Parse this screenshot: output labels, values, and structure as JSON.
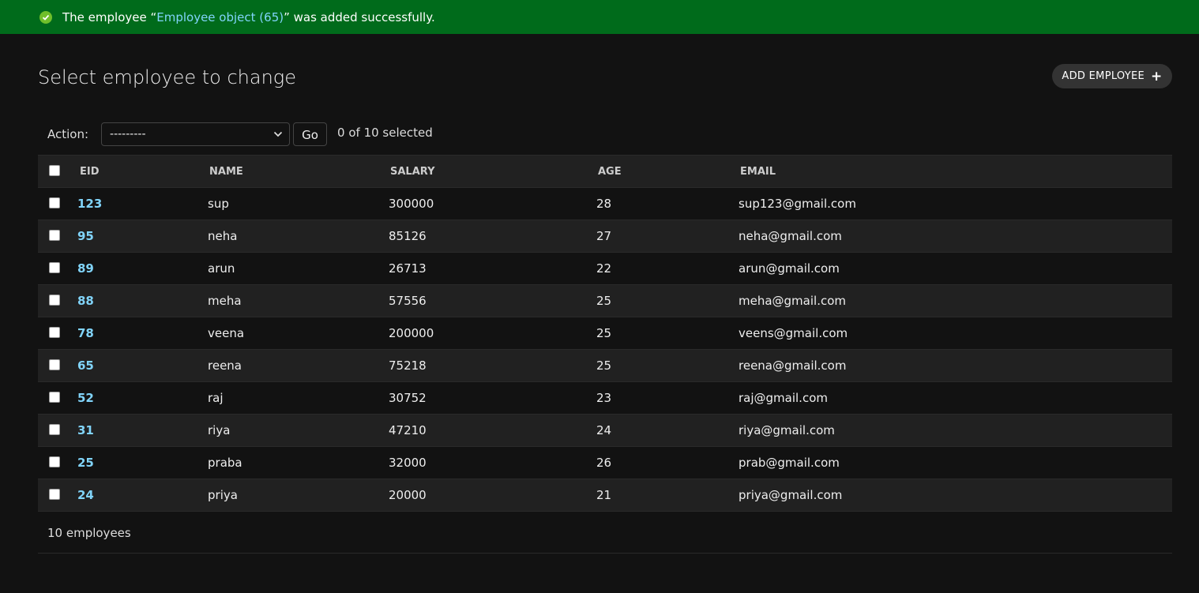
{
  "message": {
    "prefix": "The employee “",
    "link_text": "Employee object (65)",
    "suffix": "” was added successfully."
  },
  "page": {
    "title": "Select employee to change",
    "add_button_label": "ADD EMPLOYEE",
    "add_icon": "+"
  },
  "actions": {
    "label": "Action:",
    "selected_value": "---------",
    "go_label": "Go",
    "selection_counter": "0 of 10 selected"
  },
  "table": {
    "columns": [
      "EID",
      "NAME",
      "SALARY",
      "AGE",
      "EMAIL"
    ],
    "rows": [
      {
        "eid": "123",
        "name": "sup",
        "salary": "300000",
        "age": "28",
        "email": "sup123@gmail.com"
      },
      {
        "eid": "95",
        "name": "neha",
        "salary": "85126",
        "age": "27",
        "email": "neha@gmail.com"
      },
      {
        "eid": "89",
        "name": "arun",
        "salary": "26713",
        "age": "22",
        "email": "arun@gmail.com"
      },
      {
        "eid": "88",
        "name": "meha",
        "salary": "57556",
        "age": "25",
        "email": "meha@gmail.com"
      },
      {
        "eid": "78",
        "name": "veena",
        "salary": "200000",
        "age": "25",
        "email": "veens@gmail.com"
      },
      {
        "eid": "65",
        "name": "reena",
        "salary": "75218",
        "age": "25",
        "email": "reena@gmail.com"
      },
      {
        "eid": "52",
        "name": "raj",
        "salary": "30752",
        "age": "23",
        "email": "raj@gmail.com"
      },
      {
        "eid": "31",
        "name": "riya",
        "salary": "47210",
        "age": "24",
        "email": "riya@gmail.com"
      },
      {
        "eid": "25",
        "name": "praba",
        "salary": "32000",
        "age": "26",
        "email": "prab@gmail.com"
      },
      {
        "eid": "24",
        "name": "priya",
        "salary": "20000",
        "age": "21",
        "email": "priya@gmail.com"
      }
    ]
  },
  "footer": {
    "count_text": "10 employees"
  },
  "colors": {
    "success_bar": "#006b1b",
    "link": "#81d4fa",
    "background": "#121212",
    "row_alt": "#212121"
  }
}
